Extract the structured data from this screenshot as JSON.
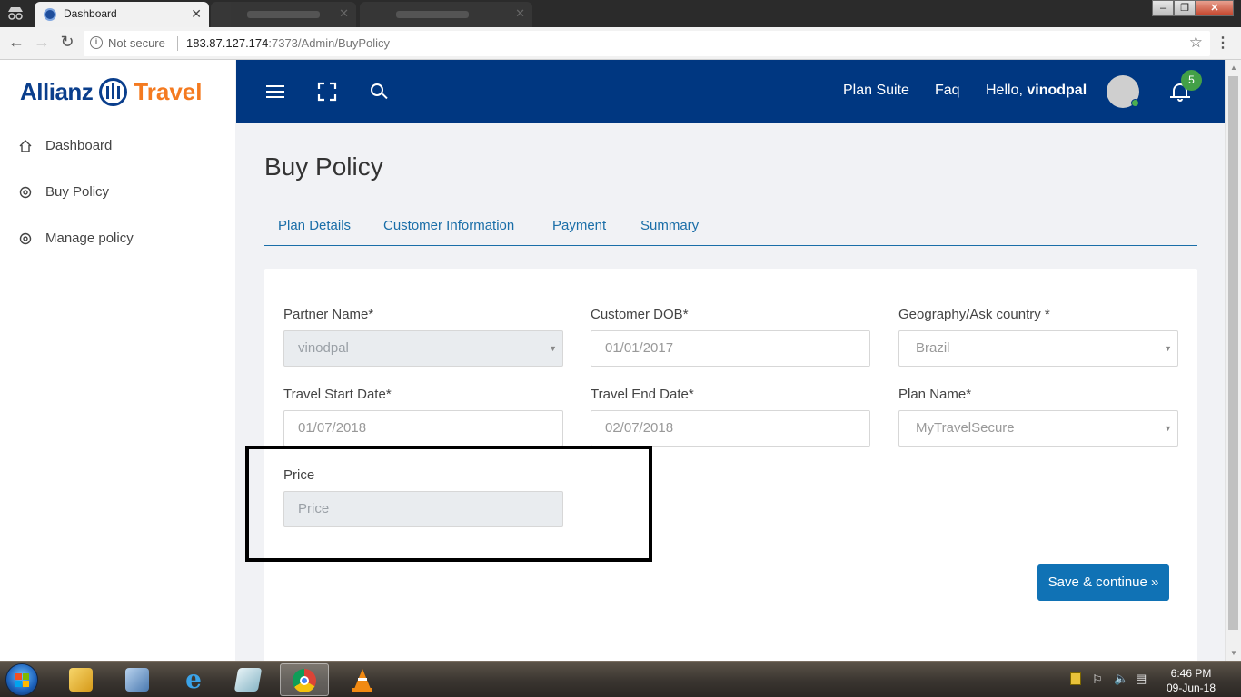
{
  "browser": {
    "active_tab_title": "Dashboard",
    "security_label": "Not secure",
    "url_host": "183.87.127.174",
    "url_rest": ":7373/Admin/BuyPolicy"
  },
  "brand": {
    "part1": "Allianz",
    "part2": "Travel"
  },
  "sidebar": {
    "items": [
      {
        "label": "Dashboard",
        "icon": "home-icon"
      },
      {
        "label": "Buy Policy",
        "icon": "gear-icon"
      },
      {
        "label": "Manage policy",
        "icon": "gear-icon"
      }
    ]
  },
  "topbar": {
    "links": [
      "Plan Suite",
      "Faq"
    ],
    "greeting": "Hello,",
    "username": "vinodpal",
    "notification_count": "5"
  },
  "page": {
    "title": "Buy Policy",
    "tabs": [
      "Plan Details",
      "Customer Information",
      "Payment",
      "Summary"
    ]
  },
  "form": {
    "partner_name": {
      "label": "Partner Name*",
      "value": "vinodpal"
    },
    "customer_dob": {
      "label": "Customer DOB*",
      "value": "01/01/2017"
    },
    "geography": {
      "label": "Geography/Ask country *",
      "value": "Brazil"
    },
    "travel_start": {
      "label": "Travel Start Date*",
      "value": "01/07/2018"
    },
    "travel_end": {
      "label": "Travel End Date*",
      "value": "02/07/2018"
    },
    "plan_name": {
      "label": "Plan Name*",
      "value": "MyTravelSecure"
    },
    "price": {
      "label": "Price",
      "placeholder": "Price"
    },
    "save_button": "Save & continue »"
  },
  "taskbar": {
    "time": "6:46 PM",
    "date": "09-Jun-18"
  },
  "colors": {
    "primary_blue": "#003781",
    "link_blue": "#1a6ea8",
    "button_blue": "#1072b5",
    "brand_orange": "#f47a20",
    "badge_green": "#43a047"
  }
}
